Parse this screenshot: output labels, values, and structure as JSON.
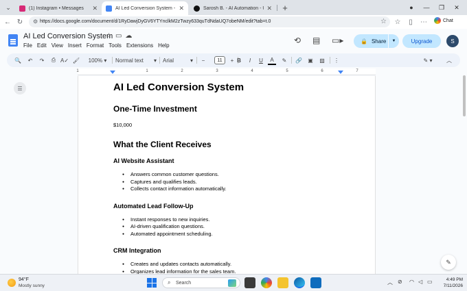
{
  "browser": {
    "tabs": [
      {
        "title": "(1) Instagram • Messages",
        "favicon_color": "#d62976"
      },
      {
        "title": "AI Led Conversion System - Google Docs",
        "favicon_color": "#4285f4"
      },
      {
        "title": "Sarosh B. - AI Automation - Upwork",
        "favicon_color": "#111111"
      }
    ],
    "close_glyph": "✕",
    "new_tab_glyph": "+",
    "url": "https://docs.google.com/document/d/1RyDawjDyGV6YTYnclkM2zTwzy633quTdNdaUQ7obeNM/edit?tab=t.0",
    "chat_label": "Chat"
  },
  "docs": {
    "title": "AI Led Conversion System",
    "menu": [
      "File",
      "Edit",
      "View",
      "Insert",
      "Format",
      "Tools",
      "Extensions",
      "Help"
    ],
    "share_label": "Share",
    "upgrade_label": "Upgrade",
    "avatar_letter": "S"
  },
  "toolbar": {
    "zoom": "100%",
    "style": "Normal text",
    "font": "Arial",
    "font_size": "11"
  },
  "ruler": {
    "numbers": [
      "1",
      "1",
      "2",
      "3",
      "4",
      "5",
      "6",
      "7"
    ]
  },
  "document": {
    "title": "AI Led Conversion System",
    "investment_heading": "One-Time Investment",
    "investment_value": "$10,000",
    "receives_heading": "What the Client Receives",
    "sections": [
      {
        "heading": "AI Website Assistant",
        "items": [
          "Answers common customer questions.",
          "Captures and qualifies leads.",
          "Collects contact information automatically."
        ]
      },
      {
        "heading": "Automated Lead Follow-Up",
        "items": [
          "Instant responses to new inquiries.",
          "AI-driven qualification questions.",
          "Automated appointment scheduling."
        ]
      },
      {
        "heading": "CRM Integration",
        "items": [
          "Creates and updates contacts automatically.",
          "Organizes lead information for the sales team."
        ]
      }
    ]
  },
  "taskbar": {
    "weather_temp": "94°F",
    "weather_desc": "Mostly sunny",
    "search_placeholder": "Search",
    "time": "4:49 PM",
    "date": "7/11/2026"
  }
}
